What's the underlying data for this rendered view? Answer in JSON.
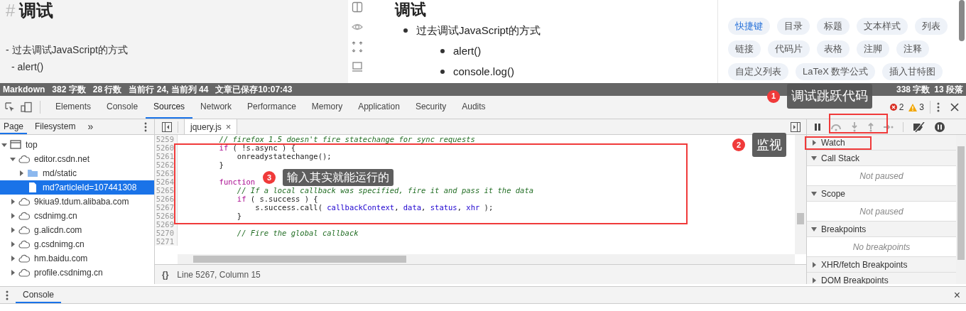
{
  "editor": {
    "heading_mark": "#",
    "heading": "调试",
    "lines": [
      {
        "text": "- 过去调试JavaScript的方式",
        "children": [
          {
            "text": "- alert()"
          }
        ]
      }
    ]
  },
  "preview": {
    "heading": "调试",
    "items": [
      {
        "text": "过去调试JavaScript的方式",
        "children": [
          {
            "text": "alert()"
          },
          {
            "text": "console.log()"
          }
        ]
      }
    ]
  },
  "help_panel": {
    "tags": [
      {
        "label": "快捷键",
        "selected": true
      },
      {
        "label": "目录",
        "selected": false
      },
      {
        "label": "标题",
        "selected": false
      },
      {
        "label": "文本样式",
        "selected": false
      },
      {
        "label": "列表",
        "selected": false
      },
      {
        "label": "链接",
        "selected": false
      },
      {
        "label": "代码片",
        "selected": false
      },
      {
        "label": "表格",
        "selected": false
      },
      {
        "label": "注脚",
        "selected": false
      },
      {
        "label": "注释",
        "selected": false
      },
      {
        "label": "自定义列表",
        "selected": false
      },
      {
        "label": "LaTeX 数学公式",
        "selected": false
      },
      {
        "label": "插入甘特图",
        "selected": false
      }
    ]
  },
  "status_bar": {
    "left": [
      "Markdown",
      "382 字数",
      "28 行数",
      "当前行 24, 当前列 44",
      "文章已保存10:07:43"
    ],
    "right": [
      "338 字数",
      "13 段落"
    ]
  },
  "devtools": {
    "tabs": [
      {
        "label": "Elements",
        "selected": false
      },
      {
        "label": "Console",
        "selected": false
      },
      {
        "label": "Sources",
        "selected": true
      },
      {
        "label": "Network",
        "selected": false
      },
      {
        "label": "Performance",
        "selected": false
      },
      {
        "label": "Memory",
        "selected": false
      },
      {
        "label": "Application",
        "selected": false
      },
      {
        "label": "Security",
        "selected": false
      },
      {
        "label": "Audits",
        "selected": false
      }
    ],
    "errors": "2",
    "warnings": "3",
    "navigator_tabs": [
      {
        "label": "Page",
        "selected": true
      },
      {
        "label": "Filesystem",
        "selected": false
      }
    ],
    "navigator_more": "»",
    "file_tabs": [
      {
        "label": "jquery.js",
        "close": "×"
      }
    ],
    "tree": [
      {
        "label": "top",
        "kind": "frame",
        "expanded": true,
        "selected": false,
        "children": [
          {
            "label": "editor.csdn.net",
            "kind": "domain",
            "expanded": true,
            "selected": false,
            "children": [
              {
                "label": "md/static",
                "kind": "folder",
                "expanded": false,
                "selected": false
              },
              {
                "label": "md?articleId=107441308",
                "kind": "file",
                "selected": true
              }
            ]
          },
          {
            "label": "9kiua9.tdum.alibaba.com",
            "kind": "domain",
            "expanded": false,
            "selected": false
          },
          {
            "label": "csdnimg.cn",
            "kind": "domain",
            "expanded": false,
            "selected": false
          },
          {
            "label": "g.alicdn.com",
            "kind": "domain",
            "expanded": false,
            "selected": false
          },
          {
            "label": "g.csdnimg.cn",
            "kind": "domain",
            "expanded": false,
            "selected": false
          },
          {
            "label": "hm.baidu.com",
            "kind": "domain",
            "expanded": false,
            "selected": false
          },
          {
            "label": "profile.csdnimg.cn",
            "kind": "domain",
            "expanded": false,
            "selected": false
          }
        ]
      }
    ],
    "code": [
      {
        "number": "5259",
        "tokens": [
          {
            "kind": "comment",
            "text": "        // firefox 1.5 doesn't fire statechange for sync requests"
          }
        ]
      },
      {
        "number": "5260",
        "tokens": [
          {
            "kind": "keyword",
            "text": "        if"
          },
          {
            "kind": "plain",
            "text": " ( !s.async ) {"
          }
        ]
      },
      {
        "number": "5261",
        "tokens": [
          {
            "kind": "plain",
            "text": "            onreadystatechange();"
          }
        ]
      },
      {
        "number": "5262",
        "tokens": [
          {
            "kind": "plain",
            "text": "        }"
          }
        ]
      },
      {
        "number": "5263"
      },
      {
        "number": "5264",
        "tokens": [
          {
            "kind": "keyword",
            "text": "        function"
          }
        ]
      },
      {
        "number": "5265",
        "tokens": [
          {
            "kind": "comment",
            "text": "            // If a local callback was specified, fire it and pass it the data"
          }
        ]
      },
      {
        "number": "5266",
        "tokens": [
          {
            "kind": "keyword",
            "text": "            if"
          },
          {
            "kind": "plain",
            "text": " ( s.success ) {"
          }
        ]
      },
      {
        "number": "5267",
        "tokens": [
          {
            "kind": "plain",
            "text": "                s.success.call( "
          },
          {
            "kind": "name",
            "text": "callbackContext"
          },
          {
            "kind": "plain",
            "text": ", "
          },
          {
            "kind": "name",
            "text": "data"
          },
          {
            "kind": "plain",
            "text": ", "
          },
          {
            "kind": "name",
            "text": "status"
          },
          {
            "kind": "plain",
            "text": ", "
          },
          {
            "kind": "name",
            "text": "xhr"
          },
          {
            "kind": "plain",
            "text": " );"
          }
        ]
      },
      {
        "number": "5268",
        "tokens": [
          {
            "kind": "plain",
            "text": "            }"
          }
        ]
      },
      {
        "number": "5269"
      },
      {
        "number": "5270",
        "tokens": [
          {
            "kind": "comment",
            "text": "            // Fire the global callback"
          }
        ]
      },
      {
        "number": "5271"
      }
    ],
    "format_button": "{}",
    "cursor_status": "Line 5267, Column 15",
    "panes": [
      {
        "title": "Watch",
        "expanded": false
      },
      {
        "title": "Call Stack",
        "expanded": true,
        "message": "Not paused"
      },
      {
        "title": "Scope",
        "expanded": true,
        "message": "Not paused"
      },
      {
        "title": "Breakpoints",
        "expanded": true,
        "message": "No breakpoints"
      },
      {
        "title": "XHR/fetch Breakpoints",
        "expanded": false
      },
      {
        "title": "DOM Breakpoints",
        "expanded": false
      }
    ],
    "drawer_tabs": [
      {
        "label": "Console",
        "selected": true
      }
    ],
    "drawer_close": "×"
  },
  "annotations": [
    {
      "number": "1",
      "text": "调试跳跃代码"
    },
    {
      "number": "2",
      "text": "监视"
    },
    {
      "number": "3",
      "text": "输入其实就能运行的"
    }
  ]
}
